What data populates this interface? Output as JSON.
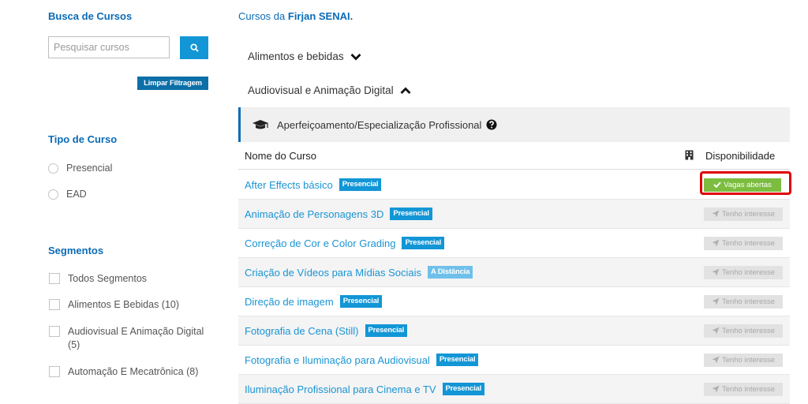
{
  "sidebar": {
    "search_title": "Busca de Cursos",
    "search_placeholder": "Pesquisar cursos",
    "search_button_icon": "search-icon",
    "clear_label": "Limpar Filtragem",
    "type_title": "Tipo de Curso",
    "type_options": [
      "Presencial",
      "EAD"
    ],
    "segments_title": "Segmentos",
    "segments": [
      {
        "label": "Todos Segmentos"
      },
      {
        "label": "Alimentos E Bebidas (10)"
      },
      {
        "label_line1": "Audiovisual E Animação Digital",
        "label_line2": "(5)"
      },
      {
        "label": "Automação E Mecatrônica (8)"
      }
    ]
  },
  "main": {
    "header_prefix": "Cursos da ",
    "header_brand": "Firjan SENAI.",
    "categories": [
      {
        "label": "Alimentos e bebidas",
        "state": "collapsed"
      },
      {
        "label": "Audiovisual e Animação Digital",
        "state": "expanded"
      }
    ],
    "subcategory": {
      "label": "Aperfeiçoamento/Especialização Profissional",
      "icon": "graduation-cap-icon",
      "help_icon": "question-circle-icon"
    },
    "table": {
      "col_name": "Nome do Curso",
      "col_icon": "building-icon",
      "col_availability": "Disponibilidade",
      "rows": [
        {
          "name": "After Effects básico",
          "badge": "Presencial",
          "badge_type": "presencial",
          "action": "Vagas abertas",
          "action_type": "open"
        },
        {
          "name": "Animação de Personagens 3D",
          "badge": "Presencial",
          "badge_type": "presencial",
          "action": "Tenho interesse",
          "action_type": "interest"
        },
        {
          "name": "Correção de Cor e Color Grading",
          "badge": "Presencial",
          "badge_type": "presencial",
          "action": "Tenho interesse",
          "action_type": "interest"
        },
        {
          "name": "Criação de Vídeos para Mídias Sociais",
          "badge": "A Distância",
          "badge_type": "distancia",
          "action": "Tenho interesse",
          "action_type": "interest"
        },
        {
          "name": "Direção de imagem",
          "badge": "Presencial",
          "badge_type": "presencial",
          "action": "Tenho interesse",
          "action_type": "interest"
        },
        {
          "name": "Fotografia de Cena (Still)",
          "badge": "Presencial",
          "badge_type": "presencial",
          "action": "Tenho interesse",
          "action_type": "interest"
        },
        {
          "name": "Fotografia e Iluminação para Audiovisual",
          "badge": "Presencial",
          "badge_type": "presencial",
          "action": "Tenho interesse",
          "action_type": "interest"
        },
        {
          "name": "Iluminação Profissional para Cinema e TV",
          "badge": "Presencial",
          "badge_type": "presencial",
          "action": "Tenho interesse",
          "action_type": "interest"
        }
      ]
    }
  },
  "colors": {
    "brand_blue": "#0b6bb5",
    "link_blue": "#1a94d4",
    "badge_presencial": "#1296d6",
    "badge_distancia": "#6ec0eb",
    "open_green": "#7cbd40",
    "highlight_red": "#e00000"
  }
}
